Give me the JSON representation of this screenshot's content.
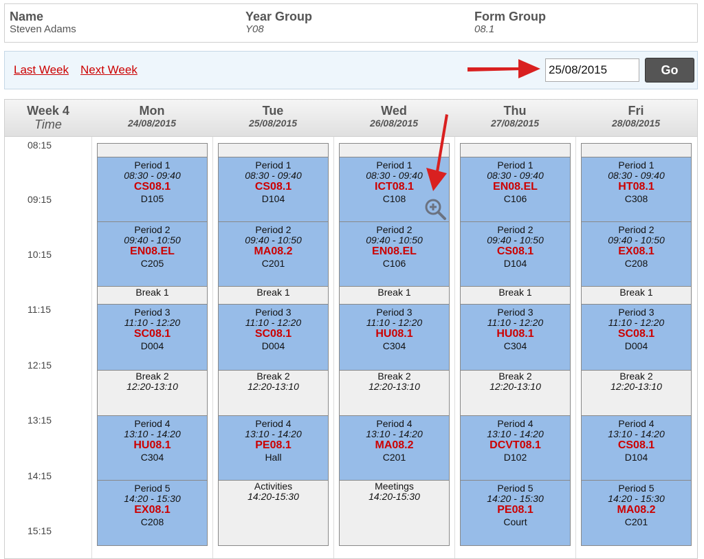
{
  "student": {
    "name_label": "Name",
    "name": "Steven Adams",
    "year_label": "Year Group",
    "year": "Y08",
    "form_label": "Form Group",
    "form": "08.1"
  },
  "nav": {
    "last_week": "Last Week",
    "next_week": "Next Week",
    "date_value": "25/08/2015",
    "go_label": "Go"
  },
  "timetable": {
    "week": "Week 4",
    "time_label": "Time",
    "times": [
      "08:15",
      "09:15",
      "10:15",
      "11:15",
      "12:15",
      "13:15",
      "14:15",
      "15:15"
    ],
    "days": [
      {
        "name": "Mon",
        "date": "24/08/2015",
        "p1": {
          "period": "Period 1",
          "time": "08:30 - 09:40",
          "class": "CS08.1",
          "room": "D105"
        },
        "p2": {
          "period": "Period 2",
          "time": "09:40 - 10:50",
          "class": "EN08.EL",
          "room": "C205"
        },
        "b1": {
          "label": "Break 1"
        },
        "p3": {
          "period": "Period 3",
          "time": "11:10 - 12:20",
          "class": "SC08.1",
          "room": "D004"
        },
        "b2": {
          "label": "Break 2",
          "time": "12:20-13:10"
        },
        "p4": {
          "period": "Period 4",
          "time": "13:10 - 14:20",
          "class": "HU08.1",
          "room": "C304"
        },
        "p5": {
          "period": "Period 5",
          "time": "14:20 - 15:30",
          "class": "EX08.1",
          "room": "C208"
        }
      },
      {
        "name": "Tue",
        "date": "25/08/2015",
        "p1": {
          "period": "Period 1",
          "time": "08:30 - 09:40",
          "class": "CS08.1",
          "room": "D104"
        },
        "p2": {
          "period": "Period 2",
          "time": "09:40 - 10:50",
          "class": "MA08.2",
          "room": "C201"
        },
        "b1": {
          "label": "Break 1"
        },
        "p3": {
          "period": "Period 3",
          "time": "11:10 - 12:20",
          "class": "SC08.1",
          "room": "D004"
        },
        "b2": {
          "label": "Break 2",
          "time": "12:20-13:10"
        },
        "p4": {
          "period": "Period 4",
          "time": "13:10 - 14:20",
          "class": "PE08.1",
          "room": "Hall"
        },
        "p5": {
          "label": "Activities",
          "time": "14:20-15:30"
        }
      },
      {
        "name": "Wed",
        "date": "26/08/2015",
        "p1": {
          "period": "Period 1",
          "time": "08:30 - 09:40",
          "class": "ICT08.1",
          "room": "C108"
        },
        "p2": {
          "period": "Period 2",
          "time": "09:40 - 10:50",
          "class": "EN08.EL",
          "room": "C106"
        },
        "b1": {
          "label": "Break 1"
        },
        "p3": {
          "period": "Period 3",
          "time": "11:10 - 12:20",
          "class": "HU08.1",
          "room": "C304"
        },
        "b2": {
          "label": "Break 2",
          "time": "12:20-13:10"
        },
        "p4": {
          "period": "Period 4",
          "time": "13:10 - 14:20",
          "class": "MA08.2",
          "room": "C201"
        },
        "p5": {
          "label": "Meetings",
          "time": "14:20-15:30"
        }
      },
      {
        "name": "Thu",
        "date": "27/08/2015",
        "p1": {
          "period": "Period 1",
          "time": "08:30 - 09:40",
          "class": "EN08.EL",
          "room": "C106"
        },
        "p2": {
          "period": "Period 2",
          "time": "09:40 - 10:50",
          "class": "CS08.1",
          "room": "D104"
        },
        "b1": {
          "label": "Break 1"
        },
        "p3": {
          "period": "Period 3",
          "time": "11:10 - 12:20",
          "class": "HU08.1",
          "room": "C304"
        },
        "b2": {
          "label": "Break 2",
          "time": "12:20-13:10"
        },
        "p4": {
          "period": "Period 4",
          "time": "13:10 - 14:20",
          "class": "DCVT08.1",
          "room": "D102"
        },
        "p5": {
          "period": "Period 5",
          "time": "14:20 - 15:30",
          "class": "PE08.1",
          "room": "Court"
        }
      },
      {
        "name": "Fri",
        "date": "28/08/2015",
        "p1": {
          "period": "Period 1",
          "time": "08:30 - 09:40",
          "class": "HT08.1",
          "room": "C308"
        },
        "p2": {
          "period": "Period 2",
          "time": "09:40 - 10:50",
          "class": "EX08.1",
          "room": "C208"
        },
        "b1": {
          "label": "Break 1"
        },
        "p3": {
          "period": "Period 3",
          "time": "11:10 - 12:20",
          "class": "SC08.1",
          "room": "D004"
        },
        "b2": {
          "label": "Break 2",
          "time": "12:20-13:10"
        },
        "p4": {
          "period": "Period 4",
          "time": "13:10 - 14:20",
          "class": "CS08.1",
          "room": "D104"
        },
        "p5": {
          "period": "Period 5",
          "time": "14:20 - 15:30",
          "class": "MA08.2",
          "room": "C201"
        }
      }
    ]
  },
  "colors": {
    "lesson_bg": "#97bce8",
    "break_bg": "#efefef",
    "class_code": "#cc0000",
    "link": "#cc0000",
    "annotation_arrow": "#d92020"
  },
  "icons": {
    "zoom": "zoom-in-icon",
    "arrow": "arrow-annotation-icon"
  }
}
